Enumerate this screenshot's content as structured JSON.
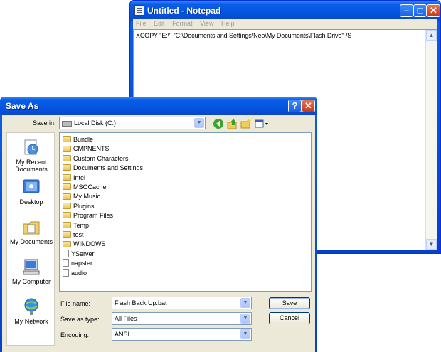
{
  "notepad": {
    "title": "Untitled - Notepad",
    "menu": [
      "File",
      "Edit",
      "Format",
      "View",
      "Help"
    ],
    "content": "XCOPY \"E:\\\" \"C:\\Documents and Settings\\Neo\\My Documents\\Flash Drive\" /S"
  },
  "dialog": {
    "title": "Save As",
    "save_in_label": "Save in:",
    "save_in_value": "Local Disk (C:)",
    "places": [
      {
        "label": "My Recent\nDocuments",
        "icon": "recent-documents-icon"
      },
      {
        "label": "Desktop",
        "icon": "desktop-icon"
      },
      {
        "label": "My Documents",
        "icon": "my-documents-icon"
      },
      {
        "label": "My Computer",
        "icon": "my-computer-icon"
      },
      {
        "label": "My Network",
        "icon": "my-network-icon"
      }
    ],
    "items": [
      {
        "name": "Bundle",
        "type": "folder"
      },
      {
        "name": "CMPNENTS",
        "type": "folder"
      },
      {
        "name": "Custom Characters",
        "type": "folder"
      },
      {
        "name": "Documents and Settings",
        "type": "folder"
      },
      {
        "name": "Intel",
        "type": "folder"
      },
      {
        "name": "MSOCache",
        "type": "folder"
      },
      {
        "name": "My Music",
        "type": "folder"
      },
      {
        "name": "Plugins",
        "type": "folder"
      },
      {
        "name": "Program Files",
        "type": "folder"
      },
      {
        "name": "Temp",
        "type": "folder"
      },
      {
        "name": "test",
        "type": "folder"
      },
      {
        "name": "WINDOWS",
        "type": "folder"
      },
      {
        "name": "YServer",
        "type": "file"
      },
      {
        "name": "napster",
        "type": "file"
      },
      {
        "name": "audio",
        "type": "file"
      }
    ],
    "file_name_label": "File name:",
    "file_name_value": "Flash Back Up.bat",
    "save_as_type_label": "Save as type:",
    "save_as_type_value": "All Files",
    "encoding_label": "Encoding:",
    "encoding_value": "ANSI",
    "save_label": "Save",
    "cancel_label": "Cancel"
  }
}
